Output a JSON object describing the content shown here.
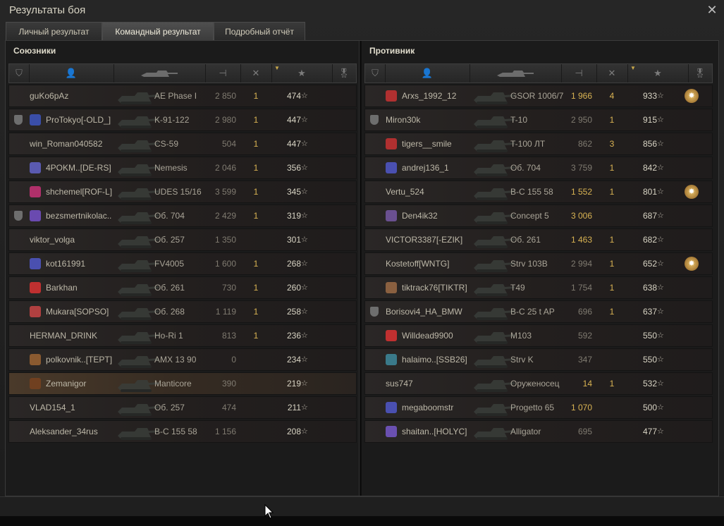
{
  "window": {
    "title": "Результаты боя",
    "close_glyph": "✕"
  },
  "tabs": [
    {
      "label": "Личный результат",
      "active": false
    },
    {
      "label": "Командный результат",
      "active": true
    },
    {
      "label": "Подробный отчёт",
      "active": false
    }
  ],
  "allies": {
    "title": "Союзники",
    "rows": [
      {
        "name": "guKo6pAz",
        "vehicle": "AE Phase I",
        "damage": "2 850",
        "kills": "1",
        "xp": "474",
        "clan": "",
        "icon": "",
        "medal": false,
        "gold_dmg": false,
        "highlight": false
      },
      {
        "name": "ProTokyo[-OLD_]",
        "vehicle": "K-91-122",
        "damage": "2 980",
        "kills": "1",
        "xp": "447",
        "clan": "#3a4ea8",
        "icon": "platoon",
        "medal": false,
        "gold_dmg": false,
        "highlight": false
      },
      {
        "name": "win_Roman040582",
        "vehicle": "CS-59",
        "damage": "504",
        "kills": "1",
        "xp": "447",
        "clan": "",
        "icon": "",
        "medal": false,
        "gold_dmg": false,
        "highlight": false
      },
      {
        "name": "4POKM..[DE-RS]",
        "vehicle": "Nemesis",
        "damage": "2 046",
        "kills": "1",
        "xp": "356",
        "clan": "#5a5ab0",
        "icon": "",
        "medal": false,
        "gold_dmg": false,
        "highlight": false
      },
      {
        "name": "shchemel[ROF-L]",
        "vehicle": "UDES 15/16",
        "damage": "3 599",
        "kills": "1",
        "xp": "345",
        "clan": "#b0306a",
        "icon": "",
        "medal": false,
        "gold_dmg": false,
        "highlight": false
      },
      {
        "name": "bezsmertnikolac..",
        "vehicle": "Об. 704",
        "damage": "2 429",
        "kills": "1",
        "xp": "319",
        "clan": "#6a4ab0",
        "icon": "platoon",
        "medal": false,
        "gold_dmg": false,
        "highlight": false
      },
      {
        "name": "viktor_volga",
        "vehicle": "Об. 257",
        "damage": "1 350",
        "kills": "",
        "xp": "301",
        "clan": "",
        "icon": "",
        "medal": false,
        "gold_dmg": false,
        "highlight": false
      },
      {
        "name": "kot161991",
        "vehicle": "FV4005",
        "damage": "1 600",
        "kills": "1",
        "xp": "268",
        "clan": "#4a50b0",
        "icon": "",
        "medal": false,
        "gold_dmg": false,
        "highlight": false
      },
      {
        "name": "Barkhan",
        "vehicle": "Об. 261",
        "damage": "730",
        "kills": "1",
        "xp": "260",
        "clan": "#c03030",
        "icon": "",
        "medal": false,
        "gold_dmg": false,
        "highlight": false
      },
      {
        "name": "Mukara[SOPSO]",
        "vehicle": "Об. 268",
        "damage": "1 119",
        "kills": "1",
        "xp": "258",
        "clan": "#b04040",
        "icon": "",
        "medal": false,
        "gold_dmg": false,
        "highlight": false
      },
      {
        "name": "HERMAN_DRINK",
        "vehicle": "Ho-Ri 1",
        "damage": "813",
        "kills": "1",
        "xp": "236",
        "clan": "",
        "icon": "",
        "medal": false,
        "gold_dmg": false,
        "highlight": false
      },
      {
        "name": "polkovnik..[TEPT]",
        "vehicle": "AMX 13 90",
        "damage": "0",
        "kills": "",
        "xp": "234",
        "clan": "#8a5a30",
        "icon": "",
        "medal": false,
        "gold_dmg": false,
        "highlight": false
      },
      {
        "name": "Zemanigor",
        "vehicle": "Manticore",
        "damage": "390",
        "kills": "",
        "xp": "219",
        "clan": "#704020",
        "icon": "",
        "medal": false,
        "gold_dmg": false,
        "highlight": true
      },
      {
        "name": "VLAD154_1",
        "vehicle": "Об. 257",
        "damage": "474",
        "kills": "",
        "xp": "211",
        "clan": "",
        "icon": "",
        "medal": false,
        "gold_dmg": false,
        "highlight": false
      },
      {
        "name": "Aleksander_34rus",
        "vehicle": "B-C 155 58",
        "damage": "1 156",
        "kills": "",
        "xp": "208",
        "clan": "",
        "icon": "",
        "medal": false,
        "gold_dmg": false,
        "highlight": false
      }
    ]
  },
  "enemies": {
    "title": "Противник",
    "rows": [
      {
        "name": "Arxs_1992_12",
        "vehicle": "GSOR 1006/7",
        "damage": "1 966",
        "kills": "4",
        "xp": "933",
        "clan": "#b03030",
        "icon": "",
        "medal": true,
        "gold_dmg": true,
        "highlight": false
      },
      {
        "name": "Miron30k",
        "vehicle": "T-10",
        "damage": "2 950",
        "kills": "1",
        "xp": "915",
        "clan": "",
        "icon": "platoon",
        "medal": false,
        "gold_dmg": false,
        "highlight": false
      },
      {
        "name": "tigers__smile",
        "vehicle": "T-100 ЛТ",
        "damage": "862",
        "kills": "3",
        "xp": "856",
        "clan": "#b03030",
        "icon": "",
        "medal": false,
        "gold_dmg": false,
        "highlight": false
      },
      {
        "name": "andrej136_1",
        "vehicle": "Об. 704",
        "damage": "3 759",
        "kills": "1",
        "xp": "842",
        "clan": "#4a50b0",
        "icon": "",
        "medal": false,
        "gold_dmg": false,
        "highlight": false
      },
      {
        "name": "Vertu_524",
        "vehicle": "B-C 155 58",
        "damage": "1 552",
        "kills": "1",
        "xp": "801",
        "clan": "",
        "icon": "",
        "medal": true,
        "gold_dmg": true,
        "highlight": false
      },
      {
        "name": "Den4ik32",
        "vehicle": "Concept 5",
        "damage": "3 006",
        "kills": "",
        "xp": "687",
        "clan": "#6a5090",
        "icon": "",
        "medal": false,
        "gold_dmg": true,
        "highlight": false
      },
      {
        "name": "VICTOR3387[-EZIK]",
        "vehicle": "Об. 261",
        "damage": "1 463",
        "kills": "1",
        "xp": "682",
        "clan": "",
        "icon": "",
        "medal": false,
        "gold_dmg": true,
        "highlight": false
      },
      {
        "name": "Kostetoff[WNTG]",
        "vehicle": "Strv 103B",
        "damage": "2 994",
        "kills": "1",
        "xp": "652",
        "clan": "",
        "icon": "",
        "medal": true,
        "gold_dmg": false,
        "highlight": false
      },
      {
        "name": "tiktrack76[TIKTR]",
        "vehicle": "T49",
        "damage": "1 754",
        "kills": "1",
        "xp": "638",
        "clan": "#8a6040",
        "icon": "",
        "medal": false,
        "gold_dmg": false,
        "highlight": false
      },
      {
        "name": "Borisovi4_HA_BMW",
        "vehicle": "B-C 25 t AP",
        "damage": "696",
        "kills": "1",
        "xp": "637",
        "clan": "",
        "icon": "platoon",
        "medal": false,
        "gold_dmg": false,
        "highlight": false
      },
      {
        "name": "Willdead9900",
        "vehicle": "M103",
        "damage": "592",
        "kills": "",
        "xp": "550",
        "clan": "#c03030",
        "icon": "",
        "medal": false,
        "gold_dmg": false,
        "highlight": false
      },
      {
        "name": "halaimo..[SSB26]",
        "vehicle": "Strv K",
        "damage": "347",
        "kills": "",
        "xp": "550",
        "clan": "#3a7a8a",
        "icon": "",
        "medal": false,
        "gold_dmg": false,
        "highlight": false
      },
      {
        "name": "sus747",
        "vehicle": "Оруженосец",
        "damage": "14",
        "kills": "1",
        "xp": "532",
        "clan": "",
        "icon": "",
        "medal": false,
        "gold_dmg": true,
        "highlight": false
      },
      {
        "name": "megaboomstr",
        "vehicle": "Progetto 65",
        "damage": "1 070",
        "kills": "",
        "xp": "500",
        "clan": "#4a50b0",
        "icon": "",
        "medal": false,
        "gold_dmg": true,
        "highlight": false
      },
      {
        "name": "shaitan..[HOLYC]",
        "vehicle": "Alligator",
        "damage": "695",
        "kills": "",
        "xp": "477",
        "clan": "#6a50b0",
        "icon": "",
        "medal": false,
        "gold_dmg": false,
        "highlight": false
      }
    ]
  },
  "icons": {
    "platoon": "shield-icon",
    "rank_header": "rank-icon",
    "player_header": "player-icon",
    "vehicle_header": "tank-icon",
    "damage_header": "damage-icon",
    "kills_header": "kills-icon",
    "xp_header": "xp-star-icon",
    "medal_header": "medal-icon"
  },
  "colors": {
    "accent_gold": "#d9b353",
    "text_main": "#bdb8a8",
    "highlight_row": "#4a3a2a"
  }
}
